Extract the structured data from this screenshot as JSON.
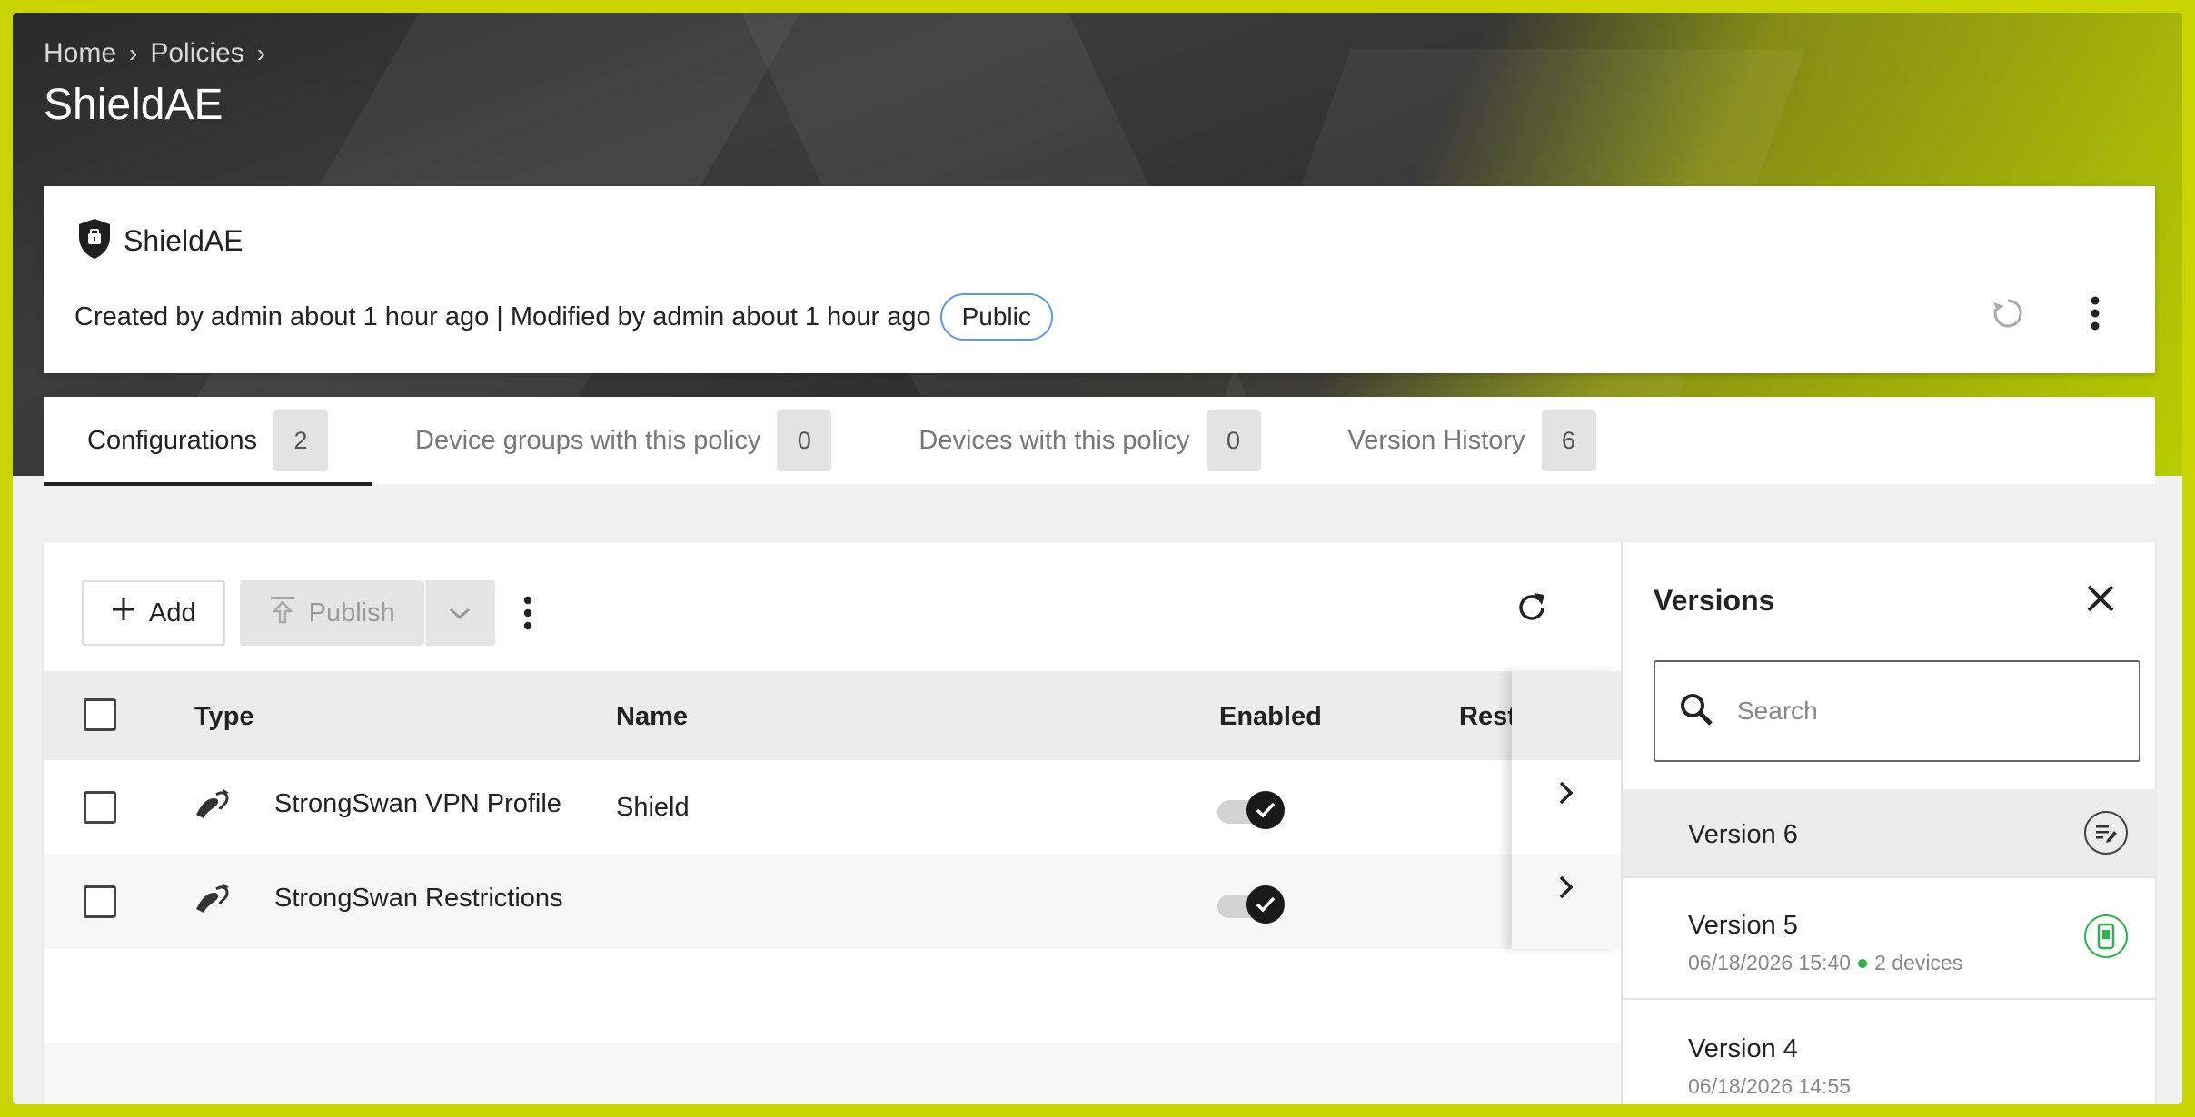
{
  "breadcrumb": {
    "home": "Home",
    "policies": "Policies"
  },
  "page": {
    "title": "ShieldAE"
  },
  "card": {
    "name": "ShieldAE",
    "meta": "Created by admin about 1 hour ago | Modified by admin about 1 hour ago",
    "visibility": "Public"
  },
  "tabs": [
    {
      "label": "Configurations",
      "count": "2"
    },
    {
      "label": "Device groups with this policy",
      "count": "0"
    },
    {
      "label": "Devices with this policy",
      "count": "0"
    },
    {
      "label": "Version History",
      "count": "6"
    }
  ],
  "toolbar": {
    "add_label": "Add",
    "publish_label": "Publish"
  },
  "table": {
    "headers": {
      "type": "Type",
      "name": "Name",
      "enabled": "Enabled",
      "rest": "Rest"
    },
    "rows": [
      {
        "type": "StrongSwan VPN Profile",
        "name": "Shield",
        "enabled": true
      },
      {
        "type": "StrongSwan Restrictions",
        "name": "",
        "enabled": true
      }
    ]
  },
  "versions": {
    "title": "Versions",
    "search_placeholder": "Search",
    "items": [
      {
        "name": "Version 6",
        "sub": "",
        "devices": ""
      },
      {
        "name": "Version 5",
        "sub": "06/18/2026 15:40",
        "devices": "2 devices"
      },
      {
        "name": "Version 4",
        "sub": "06/18/2026 14:55",
        "devices": ""
      }
    ]
  },
  "colors": {
    "accent": "#c9d400",
    "status_green": "#2fb24c",
    "pill_border": "#5a9ce6"
  }
}
